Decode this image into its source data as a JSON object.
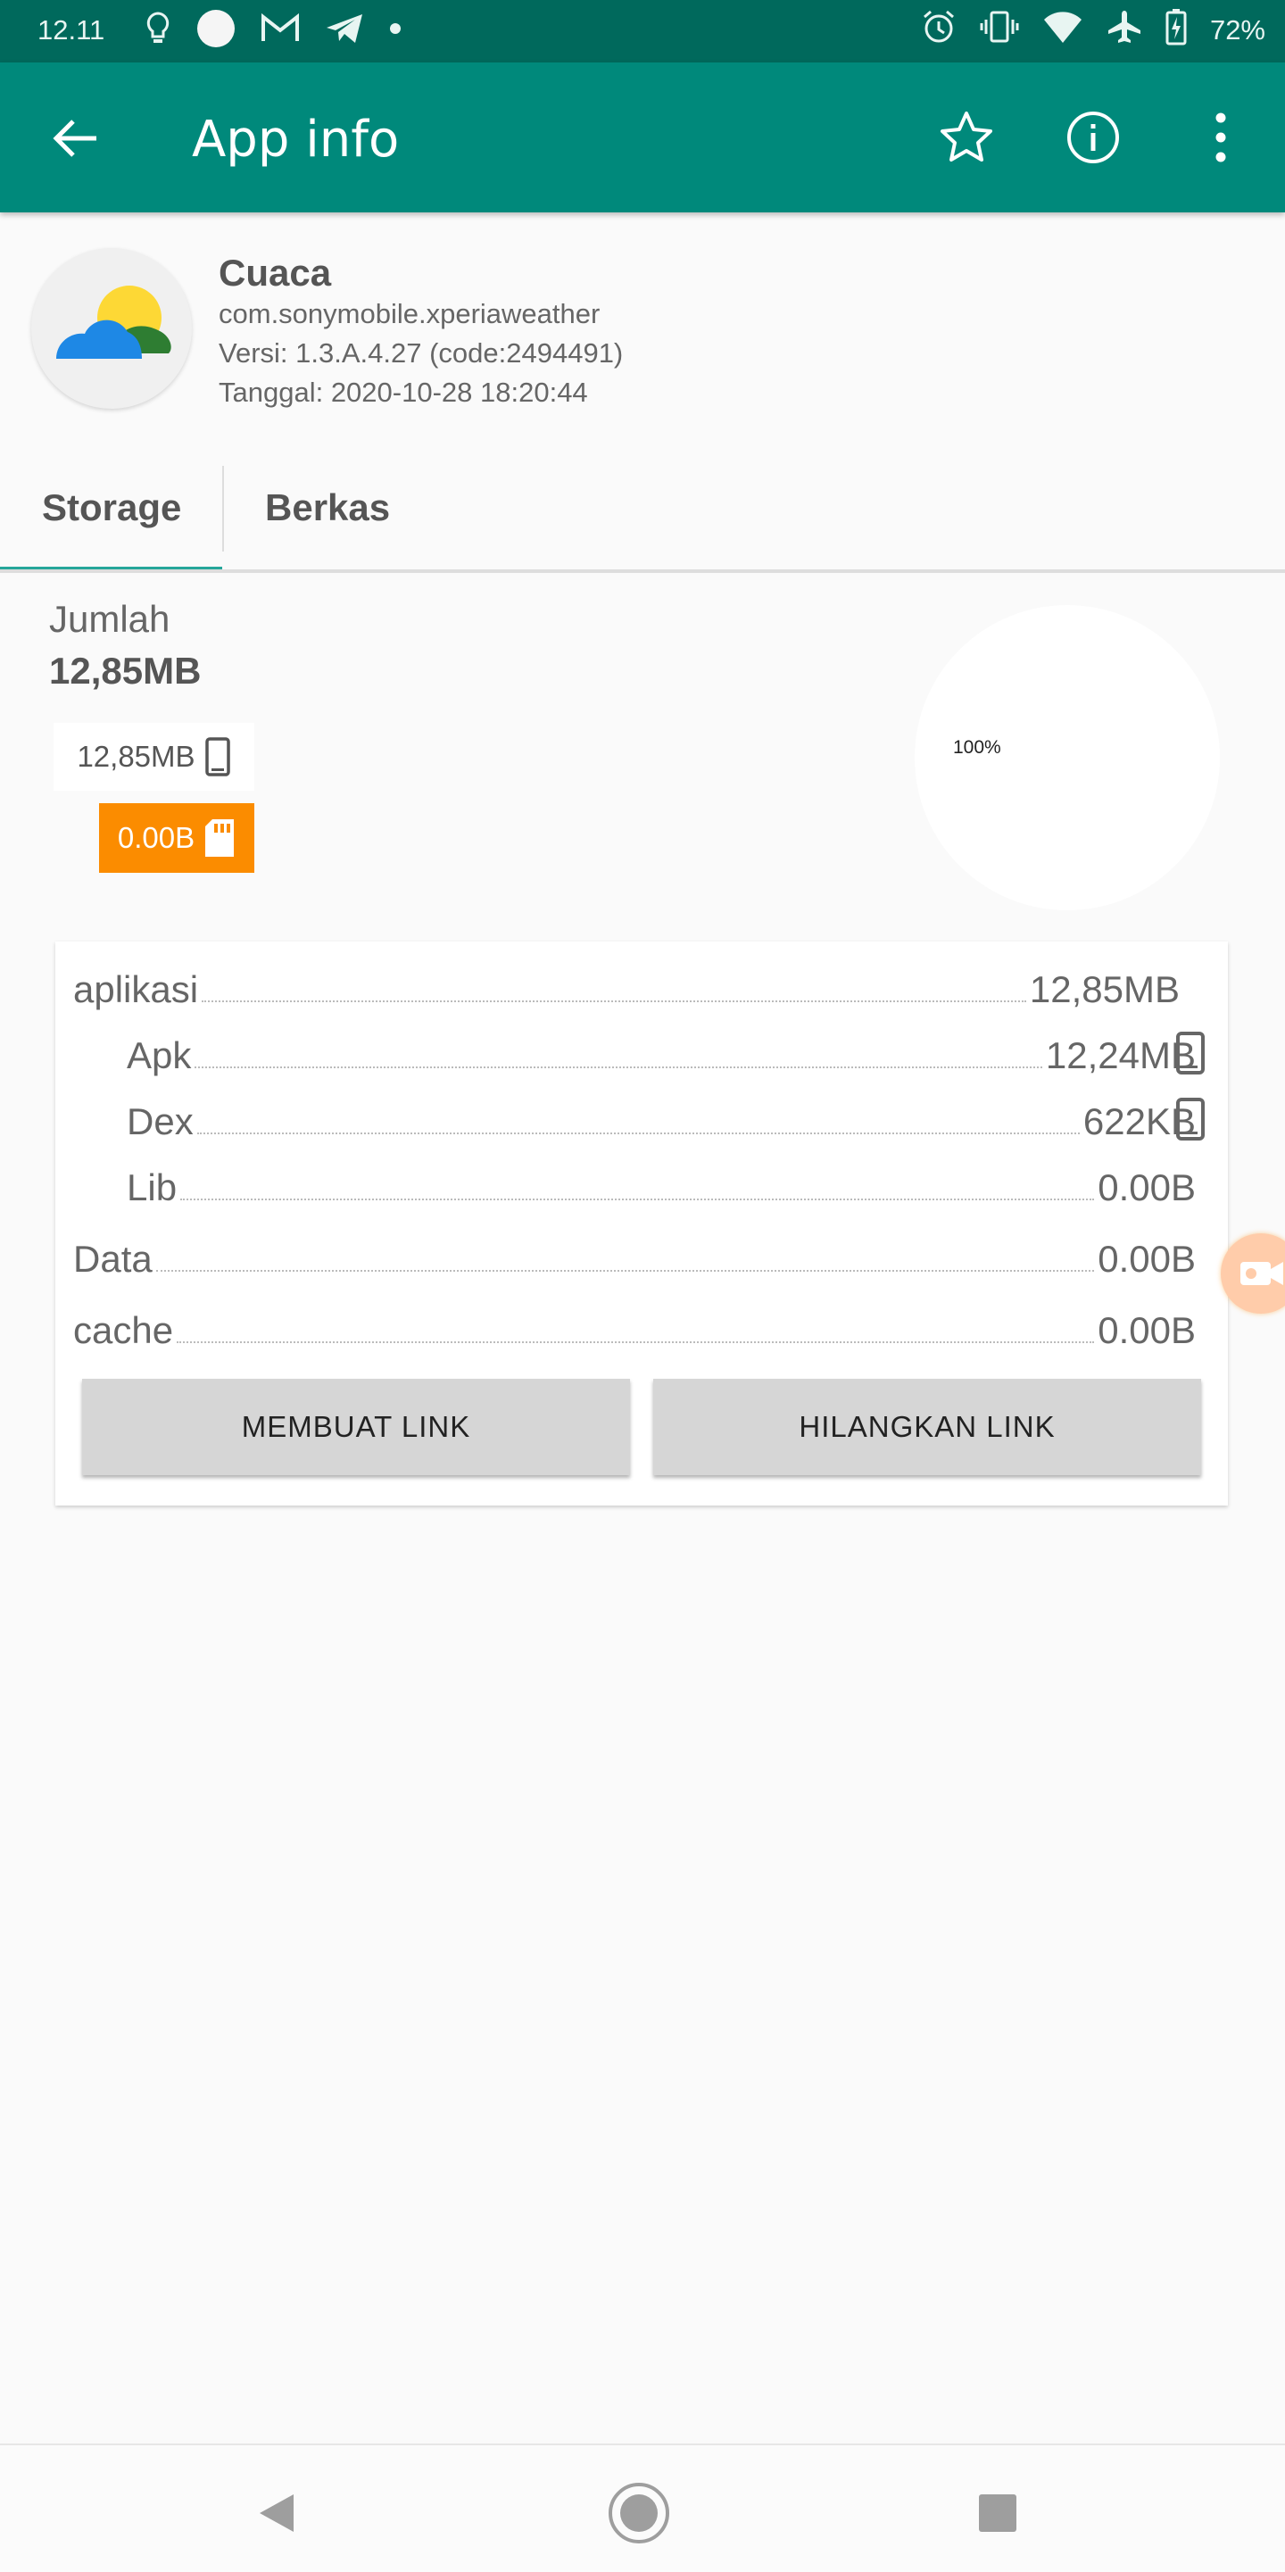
{
  "status_bar": {
    "time": "12.11",
    "battery": "72%",
    "left_icons": [
      "lightbulb-icon",
      "circle-icon",
      "gmail-icon",
      "telegram-icon",
      "dot-icon"
    ],
    "right_icons": [
      "alarm-icon",
      "vibrate-icon",
      "wifi-icon",
      "airplane-icon",
      "battery-charging-icon"
    ]
  },
  "app_bar": {
    "title": "App info",
    "actions": [
      "back-arrow-icon",
      "star-icon",
      "info-icon",
      "more-vert-icon"
    ],
    "color": "#00897b"
  },
  "app": {
    "name": "Cuaca",
    "package": "com.sonymobile.xperiaweather",
    "version": "Versi: 1.3.A.4.27 (code:2494491)",
    "date": "Tanggal: 2020-10-28 18:20:44"
  },
  "tabs": [
    {
      "label": "Storage",
      "selected": true
    },
    {
      "label": "Berkas",
      "selected": false
    }
  ],
  "summary": {
    "label": "Jumlah",
    "total": "12,85MB",
    "internal": "12,85MB",
    "external": "0.00B",
    "pie_percent": "100%",
    "external_color": "#fb8c00"
  },
  "breakdown": {
    "rows": [
      {
        "label": "aplikasi",
        "value": "12,85MB"
      },
      {
        "label": "Apk",
        "value": "12,24MB",
        "icon": "phone-icon"
      },
      {
        "label": "Dex",
        "value": "622KB",
        "icon": "phone-icon"
      },
      {
        "label": "Lib",
        "value": "0.00B"
      },
      {
        "label": "Data",
        "value": "0.00B"
      },
      {
        "label": "cache",
        "value": "0.00B"
      }
    ],
    "buttons": {
      "create_link": "MEMBUAT LINK",
      "remove_link": "HILANGKAN LINK"
    }
  },
  "nav_bar": {
    "buttons": [
      "nav-back-icon",
      "nav-home-icon",
      "nav-recents-icon"
    ]
  }
}
